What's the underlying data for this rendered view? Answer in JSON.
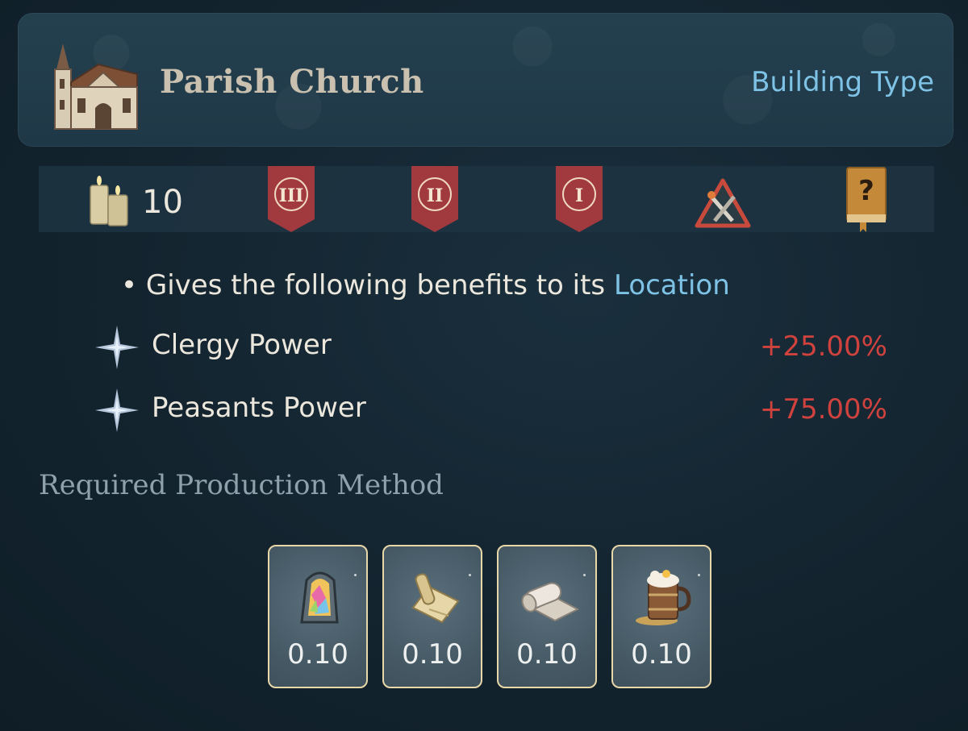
{
  "header": {
    "title": "Parish Church",
    "type_link": "Building Type",
    "icon": "church-icon"
  },
  "stats": {
    "cost_icon": "candles-icon",
    "cost_value": "10",
    "banners": [
      "III",
      "II",
      "I"
    ],
    "other_icons": [
      "crossed-tools-warning-icon",
      "question-book-icon"
    ]
  },
  "benefits": {
    "intro": "• Gives the following benefits to its ",
    "intro_link": "Location",
    "modifiers": [
      {
        "name": "Clergy Power",
        "value": "+25.00%",
        "icon": "star-icon"
      },
      {
        "name": "Peasants Power",
        "value": "+75.00%",
        "icon": "star-icon"
      }
    ]
  },
  "production": {
    "title": "Required Production Method",
    "goods": [
      {
        "icon": "stained-glass-icon",
        "value": "0.10"
      },
      {
        "icon": "paper-scroll-icon",
        "value": "0.10"
      },
      {
        "icon": "cloth-roll-icon",
        "value": "0.10"
      },
      {
        "icon": "beer-mug-icon",
        "value": "0.10"
      }
    ]
  },
  "colors": {
    "link": "#7ec3e6",
    "negative": "#d0423e",
    "banner": "#a13a3e",
    "card_border": "#e8d7a8"
  }
}
